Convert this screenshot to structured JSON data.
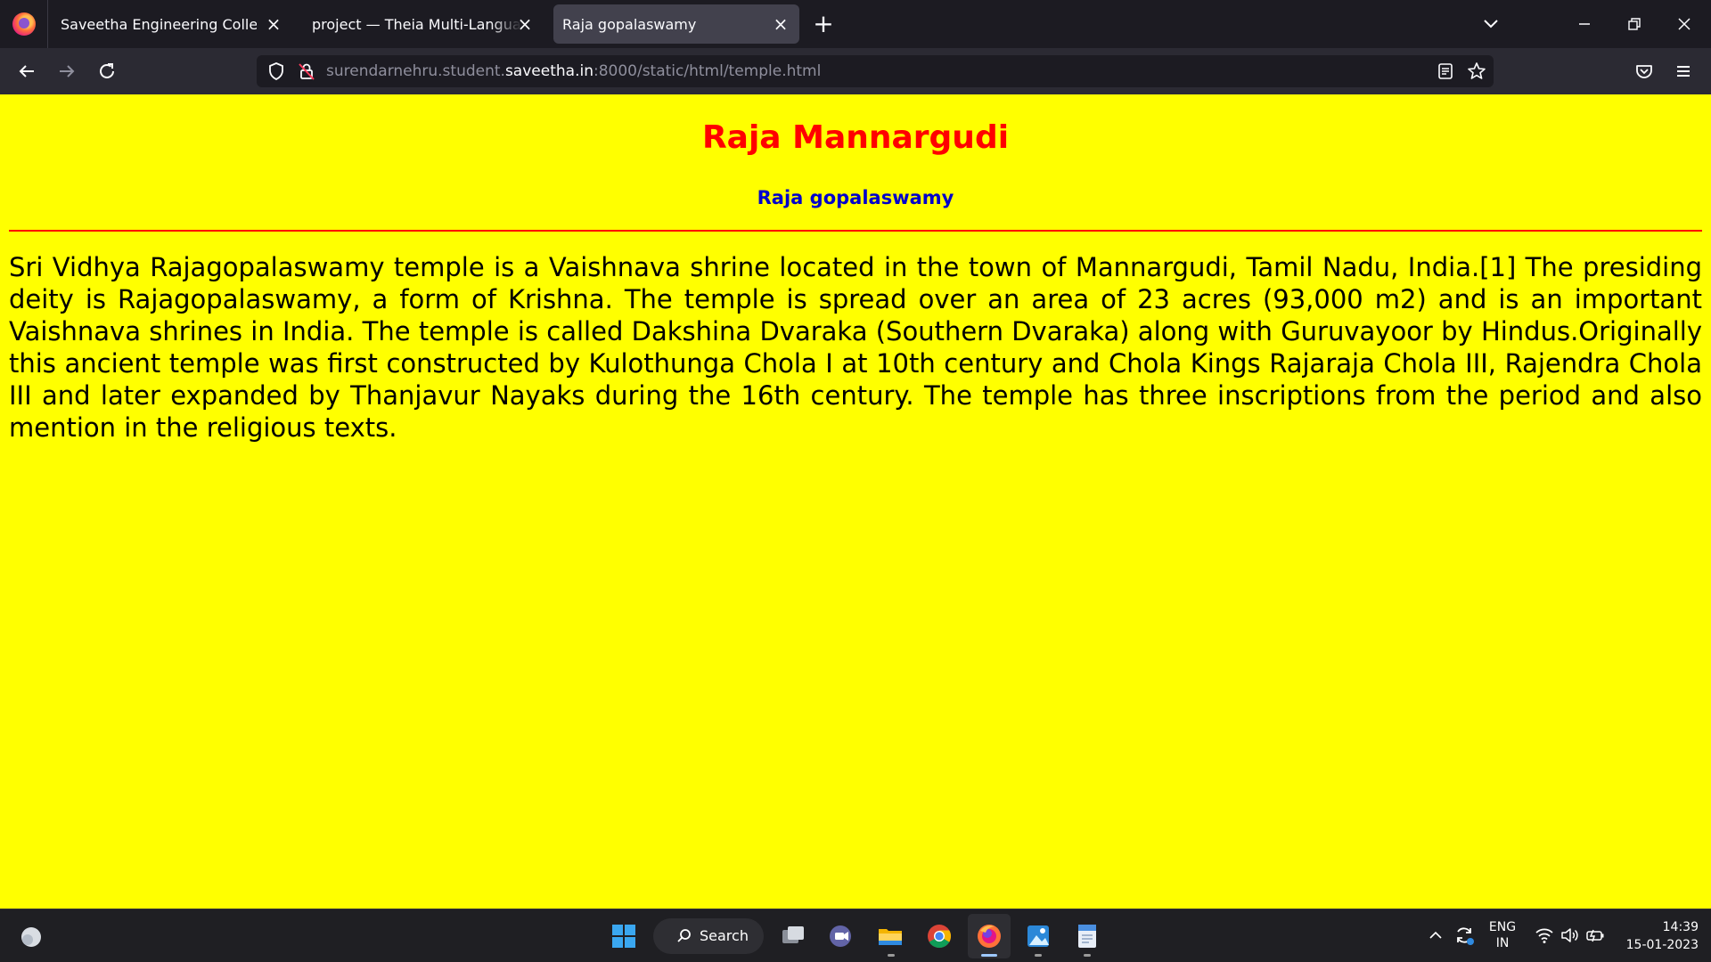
{
  "browser": {
    "tabs": [
      {
        "label": "Saveetha Engineering College",
        "active": false
      },
      {
        "label": "project — Theia Multi-Language Ex",
        "active": false
      },
      {
        "label": "Raja gopalaswamy",
        "active": true
      }
    ],
    "new_tab_symbol": "+",
    "url": {
      "prefix": "surendarnehru.student.",
      "domain": "saveetha.in",
      "suffix": ":8000/static/html/temple.html"
    }
  },
  "page": {
    "background": "#ffff00",
    "heading": "Raja Mannargudi",
    "heading_color": "#ff0000",
    "subheading": "Raja gopalaswamy",
    "subheading_color": "#0000cc",
    "rule_color": "#ff0000",
    "paragraph": "Sri Vidhya Rajagopalaswamy temple is a Vaishnava shrine located in the town of Mannargudi, Tamil Nadu, India.[1] The presiding deity is Rajagopalaswamy, a form of Krishna. The temple is spread over an area of 23 acres (93,000 m2) and is an important Vaishnava shrines in India. The temple is called Dakshina Dvaraka (Southern Dvaraka) along with Guruvayoor by Hindus.Originally this ancient temple was first constructed by Kulothunga Chola I at 10th century and Chola Kings Rajaraja Chola III, Rajendra Chola III and later expanded by Thanjavur Nayaks during the 16th century. The temple has three inscriptions from the period and also mention in the religious texts."
  },
  "taskbar": {
    "search_label": "Search",
    "language": "ENG",
    "region": "IN",
    "time": "14:39",
    "date": "15-01-2023"
  }
}
